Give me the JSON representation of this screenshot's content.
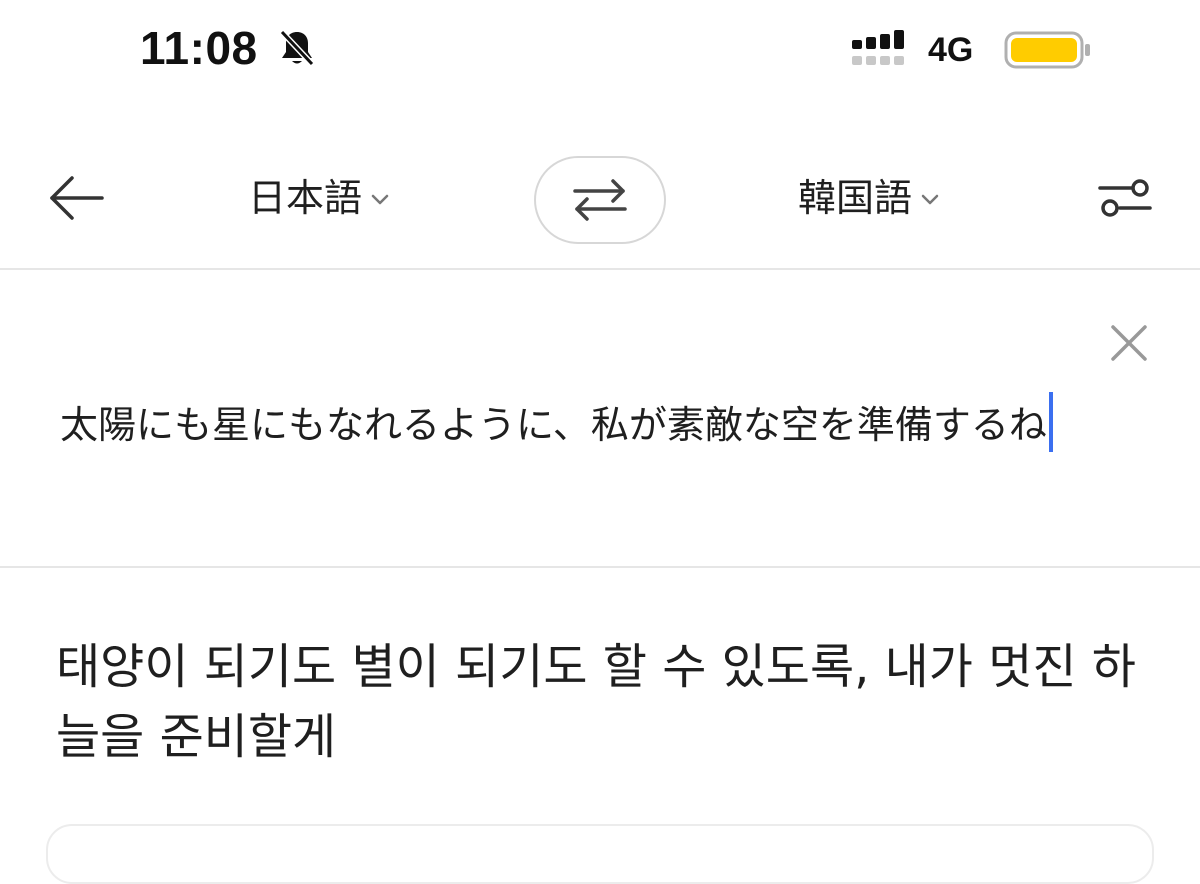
{
  "status_bar": {
    "time": "11:08",
    "network_type": "4G",
    "icons": [
      "bell-off-icon",
      "signal-icon",
      "battery-icon"
    ],
    "battery_color": "#FFCC00"
  },
  "top_bar": {
    "back_icon": "arrow-left-icon",
    "source_language": "日本語",
    "target_language": "韓国語",
    "swap_icon": "swap-arrows-icon",
    "settings_icon": "sliders-icon"
  },
  "source": {
    "text": "太陽にも星にもなれるように、私が素敵な空を準備するね",
    "clear_icon": "close-icon",
    "caret_color": "#3B6FF0"
  },
  "result": {
    "text": "태양이 되기도 별이 되기도 할 수 있도록, 내가 멋진 하늘을 준비할게"
  }
}
